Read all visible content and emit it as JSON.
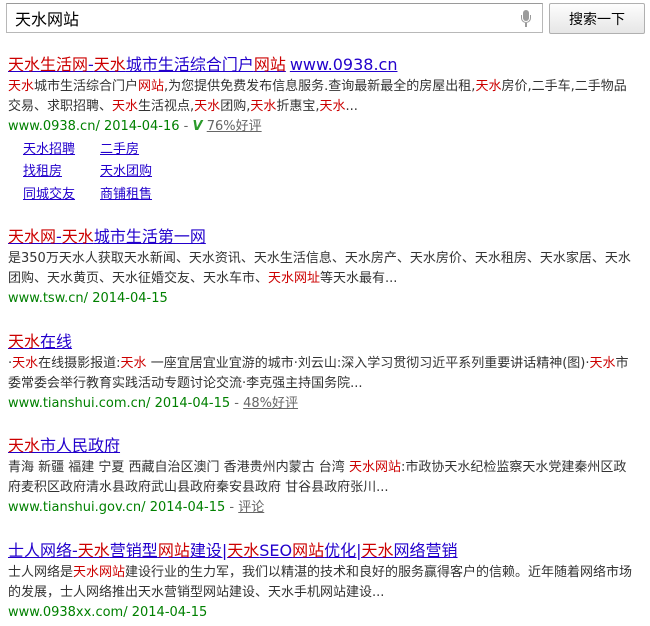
{
  "search": {
    "query": "天水网站",
    "button": "搜索一下"
  },
  "results": [
    {
      "title": [
        [
          "天水生活网",
          "hl"
        ],
        [
          "-",
          ""
        ],
        [
          "天水",
          "hl"
        ],
        [
          "城市生活综合门户",
          ""
        ],
        [
          "网站",
          "hl"
        ]
      ],
      "title_url": "www.0938.cn",
      "abstract": [
        [
          "天水",
          "hl"
        ],
        [
          "城市生活综合门户",
          ""
        ],
        [
          "网站",
          "hl"
        ],
        [
          ",为您提供免费发布信息服务.查询最新最全的房屋出租,",
          ""
        ],
        [
          "天水",
          "hl"
        ],
        [
          "房价,二手车,二手物品交易、求职招聘、",
          ""
        ],
        [
          "天水",
          "hl"
        ],
        [
          "生活视点,",
          ""
        ],
        [
          "天水",
          "hl"
        ],
        [
          "团购,",
          ""
        ],
        [
          "天水",
          "hl"
        ],
        [
          "折惠宝,",
          ""
        ],
        [
          "天水",
          "hl"
        ],
        [
          "...",
          ""
        ]
      ],
      "url": "www.0938.cn/",
      "date": "2014-04-16",
      "v_badge": "V",
      "rating": "76%好评",
      "sitelinks": [
        "天水招聘",
        "二手房",
        "找租房",
        "天水团购",
        "同城交友",
        "商铺租售"
      ]
    },
    {
      "title": [
        [
          "天水网",
          "hl"
        ],
        [
          "-",
          ""
        ],
        [
          "天水",
          "hl"
        ],
        [
          "城市生活第一网",
          ""
        ]
      ],
      "abstract": [
        [
          "是350万天水人获取天水新闻、天水资讯、天水生活信息、天水房产、天水房价、天水租房、天水家居、天水团购、天水黄页、天水征婚交友、天水车市、",
          ""
        ],
        [
          "天水网址",
          "hl"
        ],
        [
          "等天水最有...",
          ""
        ]
      ],
      "url": "www.tsw.cn/",
      "date": "2014-04-15"
    },
    {
      "title": [
        [
          "天水",
          "hl"
        ],
        [
          "在线",
          ""
        ]
      ],
      "abstract": [
        [
          "·",
          ""
        ],
        [
          "天水",
          "hl"
        ],
        [
          "在线摄影报道:",
          ""
        ],
        [
          "天水",
          "hl"
        ],
        [
          " 一座宜居宜业宜游的城市·刘云山:深入学习贯彻习近平系列重要讲话精神(图)·",
          ""
        ],
        [
          "天水",
          "hl"
        ],
        [
          "市委常委会举行教育实践活动专题讨论交流·李克强主持国务院...",
          ""
        ]
      ],
      "url": "www.tianshui.com.cn/",
      "date": "2014-04-15",
      "rating": "48%好评"
    },
    {
      "title": [
        [
          "天水",
          "hl"
        ],
        [
          "市人民政府",
          ""
        ]
      ],
      "abstract": [
        [
          "青海 新疆 福建 宁夏 西藏自治区澳门 香港贵州内蒙古 台湾 ",
          ""
        ],
        [
          "天水网站",
          "hl"
        ],
        [
          ":市政协天水纪检监察天水党建秦州区政府麦积区政府清水县政府武山县政府秦安县政府 甘谷县政府张川...",
          ""
        ]
      ],
      "url": "www.tianshui.gov.cn/",
      "date": "2014-04-15",
      "comment": "评论"
    },
    {
      "title": [
        [
          "士人网络-",
          ""
        ],
        [
          "天水",
          "hl"
        ],
        [
          "营销型",
          ""
        ],
        [
          "网站",
          "hl"
        ],
        [
          "建设|",
          ""
        ],
        [
          "天水",
          "hl"
        ],
        [
          "SEO",
          ""
        ],
        [
          "网站",
          "hl"
        ],
        [
          "优化|",
          ""
        ],
        [
          "天水",
          "hl"
        ],
        [
          "网络营销",
          ""
        ]
      ],
      "abstract": [
        [
          "士人网络是",
          ""
        ],
        [
          "天水网站",
          "hl"
        ],
        [
          "建设行业的生力军，我们以精湛的技术和良好的服务赢得客户的信赖。近年随着网络市场的发展，士人网络推出天水营销型网站建设、天水手机网站建设...",
          ""
        ]
      ],
      "url": "www.0938xx.com/",
      "date": "2014-04-15"
    }
  ]
}
